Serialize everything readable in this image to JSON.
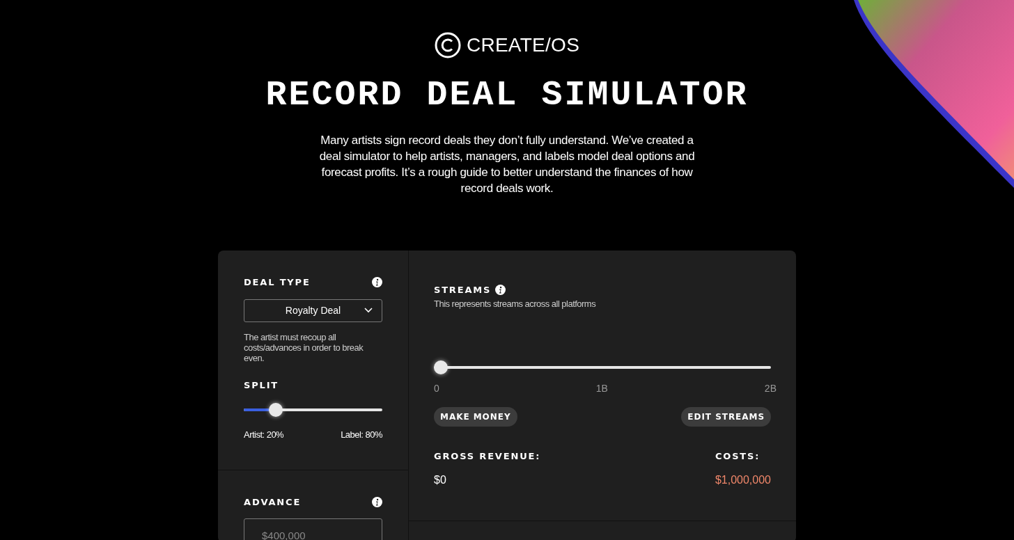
{
  "header": {
    "logo_text": "CREATE/OS",
    "title": "RECORD DEAL SIMULATOR",
    "intro": "Many artists sign record deals they don’t fully understand. We’ve created a deal simulator to help artists, managers, and labels model deal options and forecast profits. It’s a rough guide to better understand the finances of how record deals work."
  },
  "deal_type": {
    "label": "DEAL TYPE",
    "value": "Royalty Deal",
    "description": "The artist must recoup all costs/advances in order to break even."
  },
  "split": {
    "label": "SPLIT",
    "level": 0.2,
    "artist": "Artist: 20%",
    "label_share": "Label: 80%"
  },
  "advance": {
    "label": "ADVANCE",
    "placeholder": "$400,000"
  },
  "streams": {
    "label": "STREAMS",
    "description": "This represents streams across all platforms",
    "level": 0,
    "ticks": [
      "0",
      "1B",
      "2B"
    ],
    "buttons": [
      "MAKE MONEY",
      "EDIT STREAMS"
    ]
  },
  "totals": [
    {
      "label": "GROSS REVENUE:",
      "value": "$0",
      "kind": "neutral"
    },
    {
      "label": "COSTS:",
      "value": "$1,000,000",
      "kind": "negative"
    }
  ]
}
